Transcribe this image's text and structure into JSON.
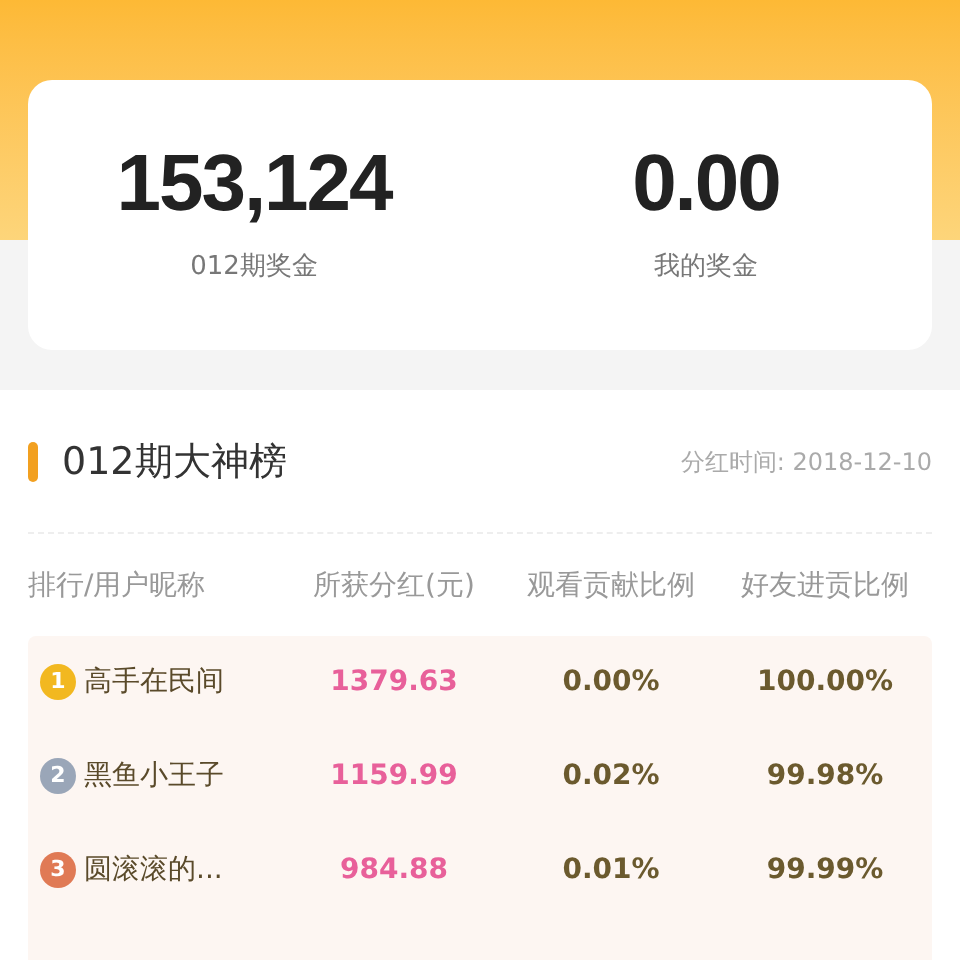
{
  "summary": [
    {
      "value": "153,124",
      "label": "012期奖金"
    },
    {
      "value": "0.00",
      "label": "我的奖金"
    }
  ],
  "board": {
    "title": "012期大神榜",
    "date": "分红时间: 2018-12-10",
    "columns": [
      "排行/用户昵称",
      "所获分红(元)",
      "观看贡献比例",
      "好友进贡比例"
    ],
    "rows": [
      {
        "rank": "1",
        "color": "#f2b820",
        "name": "高手在民间",
        "bonus": "1379.63",
        "watch": "0.00%",
        "friends": "100.00%"
      },
      {
        "rank": "2",
        "color": "#9aa6b8",
        "name": "黑鱼小王子",
        "bonus": "1159.99",
        "watch": "0.02%",
        "friends": "99.98%"
      },
      {
        "rank": "3",
        "color": "#e07a55",
        "name": "圆滚滚的...",
        "bonus": "984.88",
        "watch": "0.01%",
        "friends": "99.99%"
      }
    ]
  }
}
